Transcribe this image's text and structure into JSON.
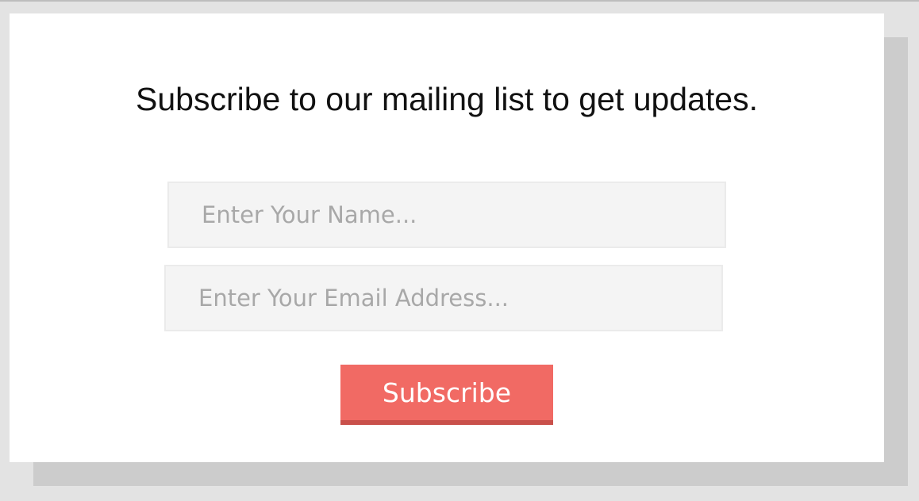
{
  "form": {
    "heading": "Subscribe to our mailing list to get updates.",
    "name_placeholder": "Enter Your Name...",
    "email_placeholder": "Enter Your Email Address...",
    "submit_label": "Subscribe"
  },
  "colors": {
    "page_background": "#e3e3e3",
    "card_shadow": "#cccccc",
    "field_background": "#f4f4f4",
    "button_accent": "#f16a64",
    "button_bottom_border": "#c9504b"
  }
}
